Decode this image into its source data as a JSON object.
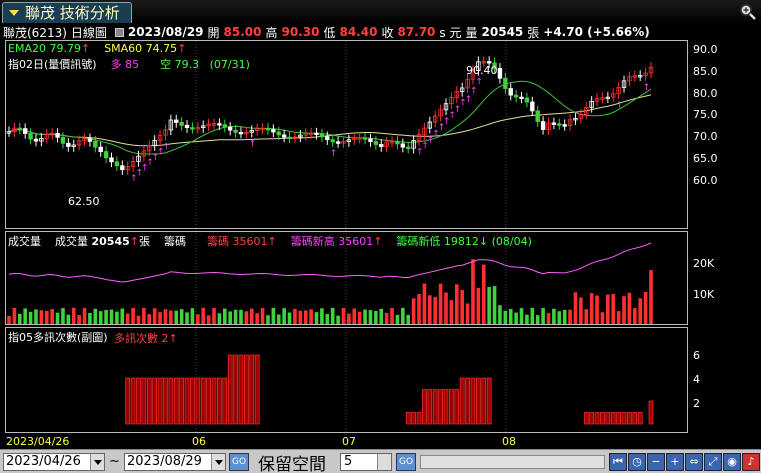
{
  "window": {
    "title": "聯茂 技術分析"
  },
  "quote": {
    "stock": "聯茂(6213)",
    "period": "日線圖",
    "date": "2023/08/29",
    "open_label": "開",
    "open": "85.00",
    "high_label": "高",
    "high": "90.30",
    "low_label": "低",
    "low": "84.40",
    "close_label": "收",
    "close": "87.70",
    "unit": "s 元",
    "vol_label": "量",
    "vol": "20545",
    "vol_unit": "張",
    "change": "+4.70 (+5.66%)"
  },
  "panel1": {
    "ema_label": "EMA20",
    "ema_value": "79.79",
    "sma_label": "SMA60",
    "sma_value": "74.75",
    "indicator": "指02日(量價訊號)",
    "long_label": "多",
    "long_value": "85",
    "short_label": "空",
    "short_value": "79.3",
    "short_date": "(07/31)",
    "high_mark": "90.40",
    "low_mark": "62.50",
    "yticks": [
      "90.0",
      "85.0",
      "80.0",
      "75.0",
      "70.0",
      "65.0",
      "60.0"
    ]
  },
  "panel2": {
    "title": "成交量",
    "vol_label": "成交量",
    "vol_value": "20545",
    "vol_unit": "張",
    "chip_label": "籌碼",
    "chip_item": "籌碼",
    "chip_value": "35601",
    "chip_high_item": "籌碼新高",
    "chip_high_value": "35601",
    "chip_low_item": "籌碼新低",
    "chip_low_value": "19812",
    "chip_low_date": "(08/04)",
    "yticks": [
      "20K",
      "10K"
    ]
  },
  "panel3": {
    "indicator": "指05多訊次數(副圖)",
    "count_label": "多訊次數",
    "count_value": "2",
    "yticks": [
      "6",
      "4",
      "2"
    ]
  },
  "xaxis": {
    "labels": [
      "2023/04/26",
      "06",
      "07",
      "08"
    ]
  },
  "toolbar": {
    "start_date": "2023/04/26",
    "tilde": "~",
    "end_date": "2023/08/29",
    "go": "GO",
    "keep_label": "保留空間",
    "keep_value": "5"
  },
  "colors": {
    "up": "#ff3030",
    "down": "#40d040",
    "ema": "#40c040",
    "sma": "#e0e0a0",
    "chip": "#ff60ff"
  }
}
